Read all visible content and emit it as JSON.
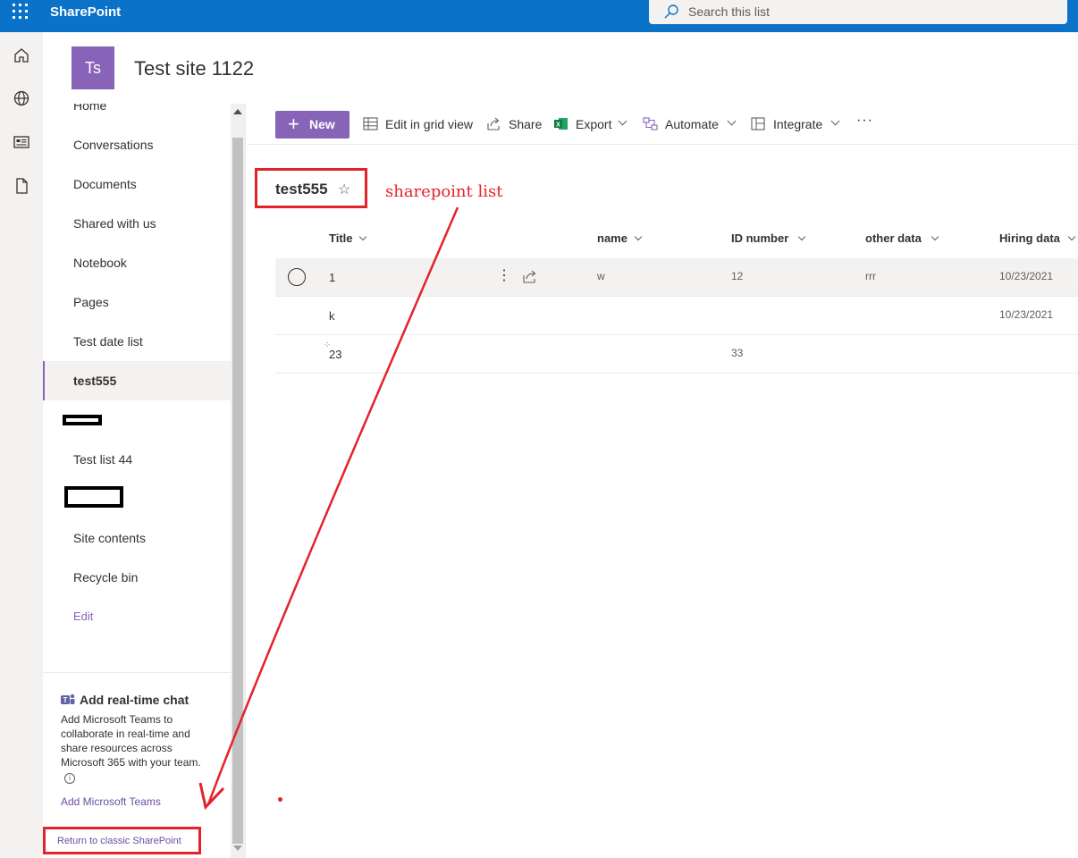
{
  "suite_bar": {
    "brand": "SharePoint",
    "search_placeholder": "Search this list"
  },
  "app_bar": {
    "icons": [
      "home-icon",
      "globe-icon",
      "news-icon",
      "file-icon"
    ]
  },
  "site": {
    "logo_initials": "Ts",
    "title": "Test site 1122"
  },
  "left_nav": {
    "items": [
      {
        "label": "Home"
      },
      {
        "label": "Conversations"
      },
      {
        "label": "Documents"
      },
      {
        "label": "Shared with us"
      },
      {
        "label": "Notebook"
      },
      {
        "label": "Pages"
      },
      {
        "label": "Test date list"
      },
      {
        "label": "test555",
        "selected": true
      },
      {
        "label": "Test list 44"
      },
      {
        "label": "Site contents"
      },
      {
        "label": "Recycle bin"
      }
    ],
    "edit_label": "Edit",
    "chat_title": "Add real-time chat",
    "chat_description": "Add Microsoft Teams to collaborate in real-time and share resources across Microsoft 365 with your team.",
    "add_teams_link": "Add Microsoft Teams",
    "classic_link": "Return to classic SharePoint"
  },
  "command_bar": {
    "new_label": "New",
    "edit_grid_label": "Edit in grid view",
    "share_label": "Share",
    "export_label": "Export",
    "automate_label": "Automate",
    "integrate_label": "Integrate",
    "more_label": "···"
  },
  "list": {
    "title": "test555",
    "annotation": "sharepoint list",
    "columns": [
      "Title",
      "name",
      "ID number",
      "other data",
      "Hiring data"
    ],
    "rows": [
      {
        "title": "1",
        "name": "w",
        "id_number": "12",
        "other_data": "rrr",
        "hiring_data": "10/23/2021"
      },
      {
        "title": "k",
        "name": "",
        "id_number": "",
        "other_data": "",
        "hiring_data": "10/23/2021"
      },
      {
        "title": "23",
        "name": "",
        "id_number": "33",
        "other_data": "",
        "hiring_data": ""
      }
    ]
  },
  "colors": {
    "suite_bar": "#0a72c9",
    "accent": "#8764b8",
    "annotation_red": "#e3222c"
  }
}
